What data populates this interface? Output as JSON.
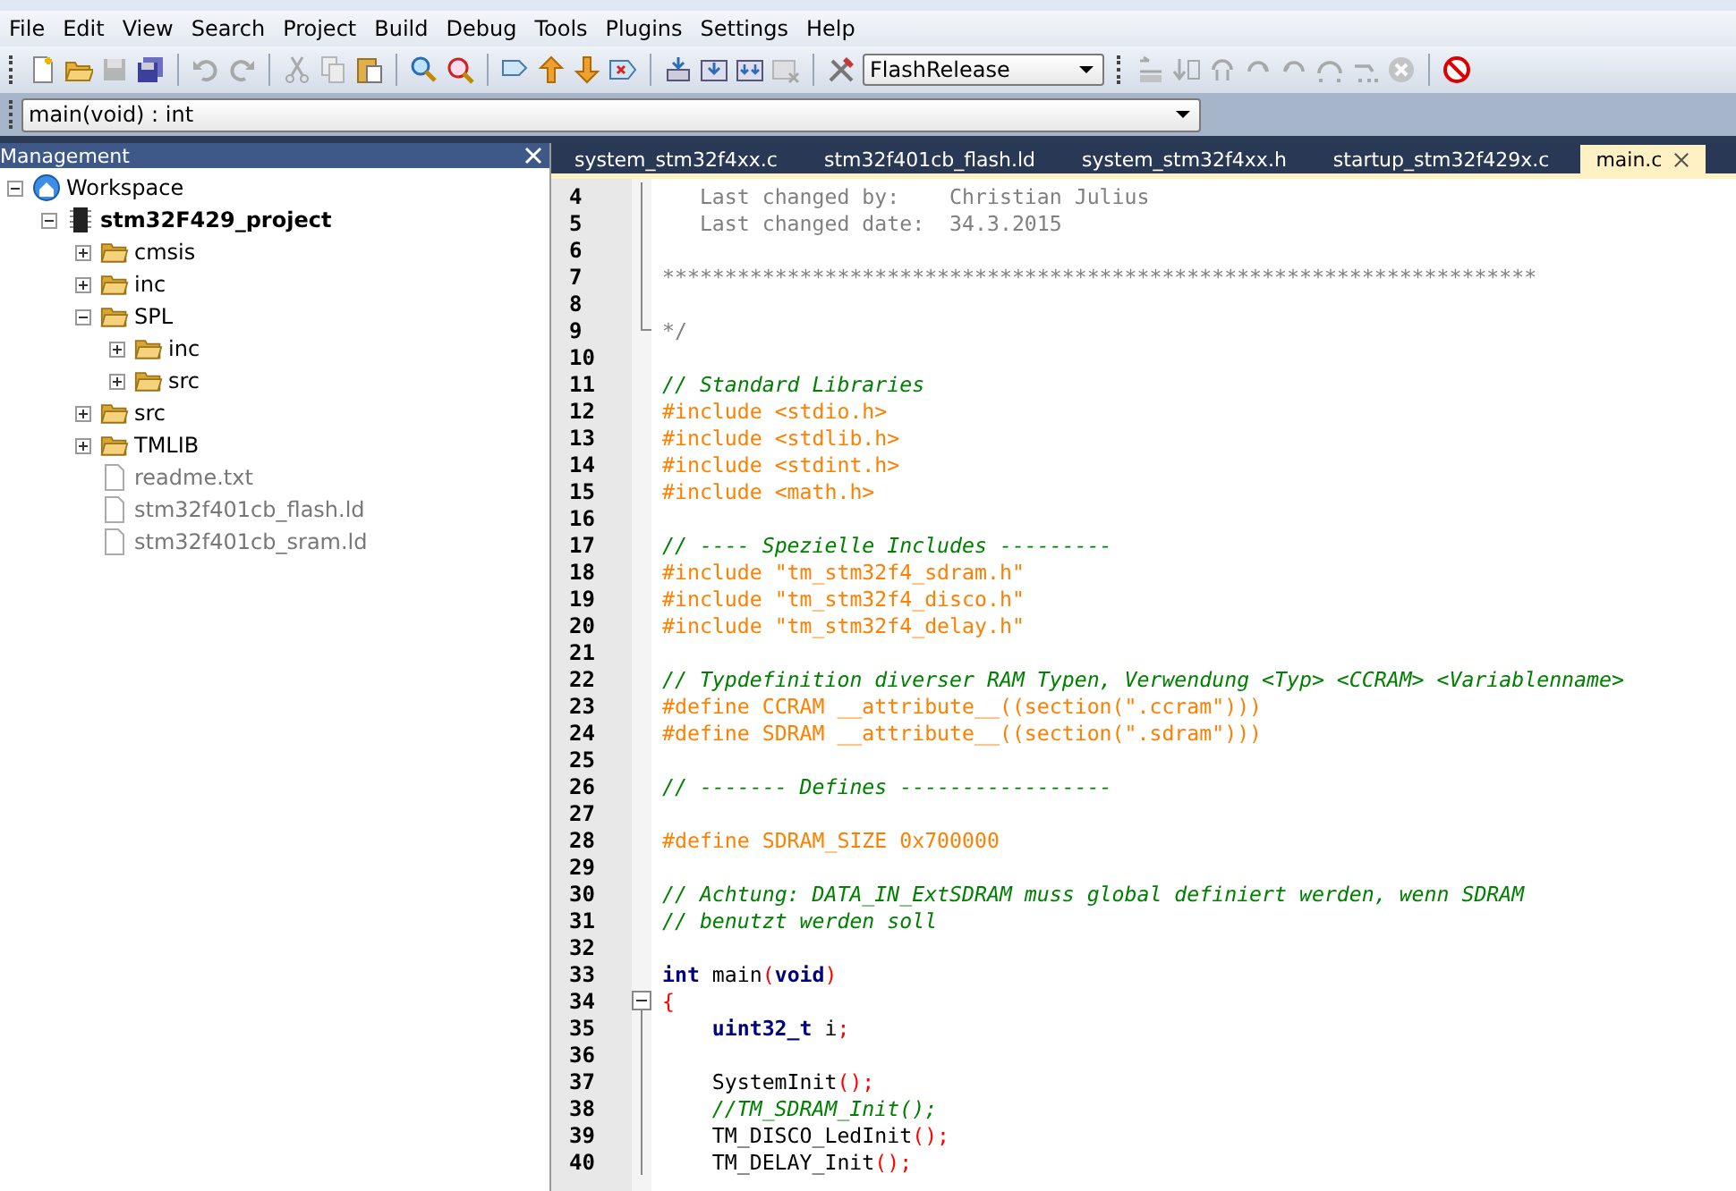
{
  "menu": [
    "File",
    "Edit",
    "View",
    "Search",
    "Project",
    "Build",
    "Debug",
    "Tools",
    "Plugins",
    "Settings",
    "Help"
  ],
  "build_target": {
    "value": "FlashRelease"
  },
  "function_selector": {
    "value": "main(void) : int"
  },
  "management": {
    "title": "Management",
    "tree": [
      {
        "label": "Workspace",
        "kind": "workspace",
        "expanded": true,
        "children": [
          {
            "label": "stm32F429_project",
            "kind": "project",
            "expanded": true,
            "children": [
              {
                "label": "cmsis",
                "kind": "folder",
                "expanded": false
              },
              {
                "label": "inc",
                "kind": "folder",
                "expanded": false
              },
              {
                "label": "SPL",
                "kind": "folder",
                "expanded": true,
                "children": [
                  {
                    "label": "inc",
                    "kind": "folder",
                    "expanded": false
                  },
                  {
                    "label": "src",
                    "kind": "folder",
                    "expanded": false
                  }
                ]
              },
              {
                "label": "src",
                "kind": "folder",
                "expanded": false
              },
              {
                "label": "TMLIB",
                "kind": "folder",
                "expanded": false
              },
              {
                "label": "readme.txt",
                "kind": "file"
              },
              {
                "label": "stm32f401cb_flash.ld",
                "kind": "file"
              },
              {
                "label": "stm32f401cb_sram.ld",
                "kind": "file"
              }
            ]
          }
        ]
      }
    ]
  },
  "tabs": [
    {
      "label": "system_stm32f4xx.c",
      "selected": false
    },
    {
      "label": "stm32f401cb_flash.ld",
      "selected": false
    },
    {
      "label": "system_stm32f4xx.h",
      "selected": false
    },
    {
      "label": "startup_stm32f429x.c",
      "selected": false
    },
    {
      "label": "main.c",
      "selected": true
    }
  ],
  "editor": {
    "lines": [
      {
        "number": "4",
        "kind": "fold-body",
        "segments": [
          {
            "kind": "doc",
            "text": "   Last changed by:    Christian Julius"
          }
        ]
      },
      {
        "number": "5",
        "kind": "fold-body",
        "segments": [
          {
            "kind": "doc",
            "text": "   Last changed date:  34.3.2015"
          }
        ]
      },
      {
        "number": "6",
        "kind": "fold-body"
      },
      {
        "number": "7",
        "kind": "fold-body",
        "segments": [
          {
            "kind": "doc",
            "text": "**********************************************************************"
          }
        ]
      },
      {
        "number": "8",
        "kind": "fold-body"
      },
      {
        "number": "9",
        "kind": "fold-end",
        "segments": [
          {
            "kind": "doc",
            "text": "*/"
          }
        ]
      },
      {
        "number": "10",
        "kind": "plain"
      },
      {
        "number": "11",
        "kind": "plain",
        "segments": [
          {
            "kind": "comment",
            "text": "// Standard Libraries"
          }
        ]
      },
      {
        "number": "12",
        "kind": "plain",
        "segments": [
          {
            "kind": "preproc",
            "text": "#include <stdio.h>"
          }
        ]
      },
      {
        "number": "13",
        "kind": "plain",
        "segments": [
          {
            "kind": "preproc",
            "text": "#include <stdlib.h>"
          }
        ]
      },
      {
        "number": "14",
        "kind": "plain",
        "segments": [
          {
            "kind": "preproc",
            "text": "#include <stdint.h>"
          }
        ]
      },
      {
        "number": "15",
        "kind": "plain",
        "segments": [
          {
            "kind": "preproc",
            "text": "#include <math.h>"
          }
        ]
      },
      {
        "number": "16",
        "kind": "plain"
      },
      {
        "number": "17",
        "kind": "plain",
        "segments": [
          {
            "kind": "comment",
            "text": "// ---- Spezielle Includes ---------"
          }
        ]
      },
      {
        "number": "18",
        "kind": "plain",
        "segments": [
          {
            "kind": "preproc",
            "text": "#include \"tm_stm32f4_sdram.h\""
          }
        ]
      },
      {
        "number": "19",
        "kind": "plain",
        "segments": [
          {
            "kind": "preproc",
            "text": "#include \"tm_stm32f4_disco.h\""
          }
        ]
      },
      {
        "number": "20",
        "kind": "plain",
        "segments": [
          {
            "kind": "preproc",
            "text": "#include \"tm_stm32f4_delay.h\""
          }
        ]
      },
      {
        "number": "21",
        "kind": "plain"
      },
      {
        "number": "22",
        "kind": "plain",
        "segments": [
          {
            "kind": "comment",
            "text": "// Typdefinition diverser RAM Typen, Verwendung <Typ> <CCRAM> <Variablenname>"
          }
        ]
      },
      {
        "number": "23",
        "kind": "plain",
        "segments": [
          {
            "kind": "preproc",
            "text": "#define CCRAM __attribute__((section(\".ccram\")))"
          }
        ]
      },
      {
        "number": "24",
        "kind": "plain",
        "segments": [
          {
            "kind": "preproc",
            "text": "#define SDRAM __attribute__((section(\".sdram\")))"
          }
        ]
      },
      {
        "number": "25",
        "kind": "plain"
      },
      {
        "number": "26",
        "kind": "plain",
        "segments": [
          {
            "kind": "comment",
            "text": "// ------- Defines -----------------"
          }
        ]
      },
      {
        "number": "27",
        "kind": "plain"
      },
      {
        "number": "28",
        "kind": "plain",
        "segments": [
          {
            "kind": "preproc",
            "text": "#define SDRAM_SIZE 0x700000"
          }
        ]
      },
      {
        "number": "29",
        "kind": "plain"
      },
      {
        "number": "30",
        "kind": "plain",
        "segments": [
          {
            "kind": "comment",
            "text": "// Achtung: DATA_IN_ExtSDRAM muss global definiert werden, wenn SDRAM"
          }
        ]
      },
      {
        "number": "31",
        "kind": "plain",
        "segments": [
          {
            "kind": "comment",
            "text": "// benutzt werden soll"
          }
        ]
      },
      {
        "number": "32",
        "kind": "plain"
      },
      {
        "number": "33",
        "kind": "plain",
        "segments": [
          {
            "kind": "keyword",
            "text": "int"
          },
          {
            "kind": "plain",
            "text": " main"
          },
          {
            "kind": "punct",
            "text": "("
          },
          {
            "kind": "keyword",
            "text": "void"
          },
          {
            "kind": "punct",
            "text": ")"
          }
        ]
      },
      {
        "number": "34",
        "kind": "fold-start",
        "segments": [
          {
            "kind": "punct",
            "text": "{"
          }
        ]
      },
      {
        "number": "35",
        "kind": "fold-body",
        "indent": true,
        "segments": [
          {
            "kind": "keyword",
            "text": "uint32_t"
          },
          {
            "kind": "plain",
            "text": " i"
          },
          {
            "kind": "punct",
            "text": ";"
          }
        ]
      },
      {
        "number": "36",
        "kind": "fold-body"
      },
      {
        "number": "37",
        "kind": "fold-body",
        "indent": true,
        "segments": [
          {
            "kind": "plain",
            "text": "SystemInit"
          },
          {
            "kind": "punct",
            "text": "();"
          }
        ]
      },
      {
        "number": "38",
        "kind": "fold-body",
        "indent": true,
        "segments": [
          {
            "kind": "comment",
            "text": "//TM_SDRAM_Init();"
          }
        ]
      },
      {
        "number": "39",
        "kind": "fold-body",
        "indent": true,
        "segments": [
          {
            "kind": "plain",
            "text": "TM_DISCO_LedInit"
          },
          {
            "kind": "punct",
            "text": "();"
          }
        ]
      },
      {
        "number": "40",
        "kind": "fold-body",
        "indent": true,
        "segments": [
          {
            "kind": "plain",
            "text": "TM_DELAY_Init"
          },
          {
            "kind": "punct",
            "text": "();"
          }
        ]
      }
    ]
  }
}
